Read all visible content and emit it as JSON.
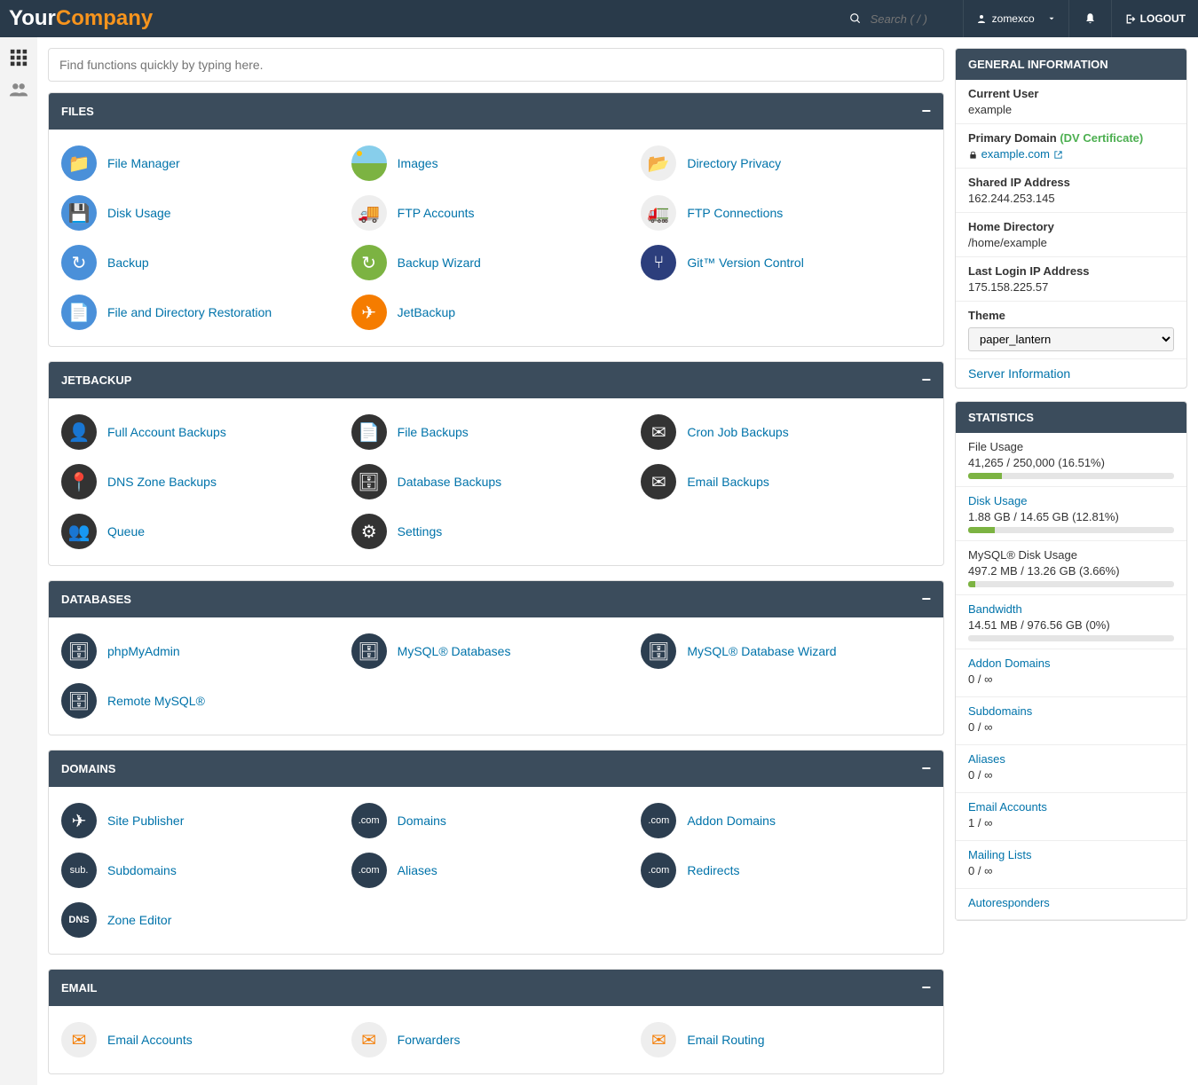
{
  "header": {
    "logo_your": "Your",
    "logo_company": "Company",
    "search_placeholder": "Search ( / )",
    "user": "zomexco",
    "logout": "LOGOUT"
  },
  "quick_search_placeholder": "Find functions quickly by typing here.",
  "panels": {
    "files": {
      "title": "FILES",
      "items": [
        "File Manager",
        "Images",
        "Directory Privacy",
        "Disk Usage",
        "FTP Accounts",
        "FTP Connections",
        "Backup",
        "Backup Wizard",
        "Git™ Version Control",
        "File and Directory Restoration",
        "JetBackup"
      ]
    },
    "jetbackup": {
      "title": "JETBACKUP",
      "items": [
        "Full Account Backups",
        "File Backups",
        "Cron Job Backups",
        "DNS Zone Backups",
        "Database Backups",
        "Email Backups",
        "Queue",
        "Settings"
      ]
    },
    "databases": {
      "title": "DATABASES",
      "items": [
        "phpMyAdmin",
        "MySQL® Databases",
        "MySQL® Database Wizard",
        "Remote MySQL®"
      ]
    },
    "domains": {
      "title": "DOMAINS",
      "items": [
        "Site Publisher",
        "Domains",
        "Addon Domains",
        "Subdomains",
        "Aliases",
        "Redirects",
        "Zone Editor"
      ]
    },
    "email": {
      "title": "EMAIL",
      "items": [
        "Email Accounts",
        "Forwarders",
        "Email Routing"
      ]
    }
  },
  "general_info": {
    "title": "GENERAL INFORMATION",
    "current_user_label": "Current User",
    "current_user": "example",
    "primary_domain_label": "Primary Domain",
    "dv_cert": "(DV Certificate)",
    "primary_domain": "example.com",
    "shared_ip_label": "Shared IP Address",
    "shared_ip": "162.244.253.145",
    "home_dir_label": "Home Directory",
    "home_dir": "/home/example",
    "last_login_label": "Last Login IP Address",
    "last_login": "175.158.225.57",
    "theme_label": "Theme",
    "theme_value": "paper_lantern",
    "server_info": "Server Information"
  },
  "stats": {
    "title": "STATISTICS",
    "items": [
      {
        "label": "File Usage",
        "value": "41,265 / 250,000",
        "pct_text": "(16.51%)",
        "pct": 16.51,
        "link": false
      },
      {
        "label": "Disk Usage",
        "value": "1.88 GB / 14.65 GB",
        "pct_text": "(12.81%)",
        "pct": 12.81,
        "link": true
      },
      {
        "label": "MySQL® Disk Usage",
        "value": "497.2 MB / 13.26 GB",
        "pct_text": "(3.66%)",
        "pct": 3.66,
        "link": false
      },
      {
        "label": "Bandwidth",
        "value": "14.51 MB / 976.56 GB",
        "pct_text": "(0%)",
        "pct": 0,
        "link": true
      },
      {
        "label": "Addon Domains",
        "value": "0 / ∞",
        "pct_text": "",
        "pct": null,
        "link": true
      },
      {
        "label": "Subdomains",
        "value": "0 / ∞",
        "pct_text": "",
        "pct": null,
        "link": true
      },
      {
        "label": "Aliases",
        "value": "0 / ∞",
        "pct_text": "",
        "pct": null,
        "link": true
      },
      {
        "label": "Email Accounts",
        "value": "1 / ∞",
        "pct_text": "",
        "pct": null,
        "link": true
      },
      {
        "label": "Mailing Lists",
        "value": "0 / ∞",
        "pct_text": "",
        "pct": null,
        "link": true
      },
      {
        "label": "Autoresponders",
        "value": "",
        "pct_text": "",
        "pct": null,
        "link": true
      }
    ]
  }
}
